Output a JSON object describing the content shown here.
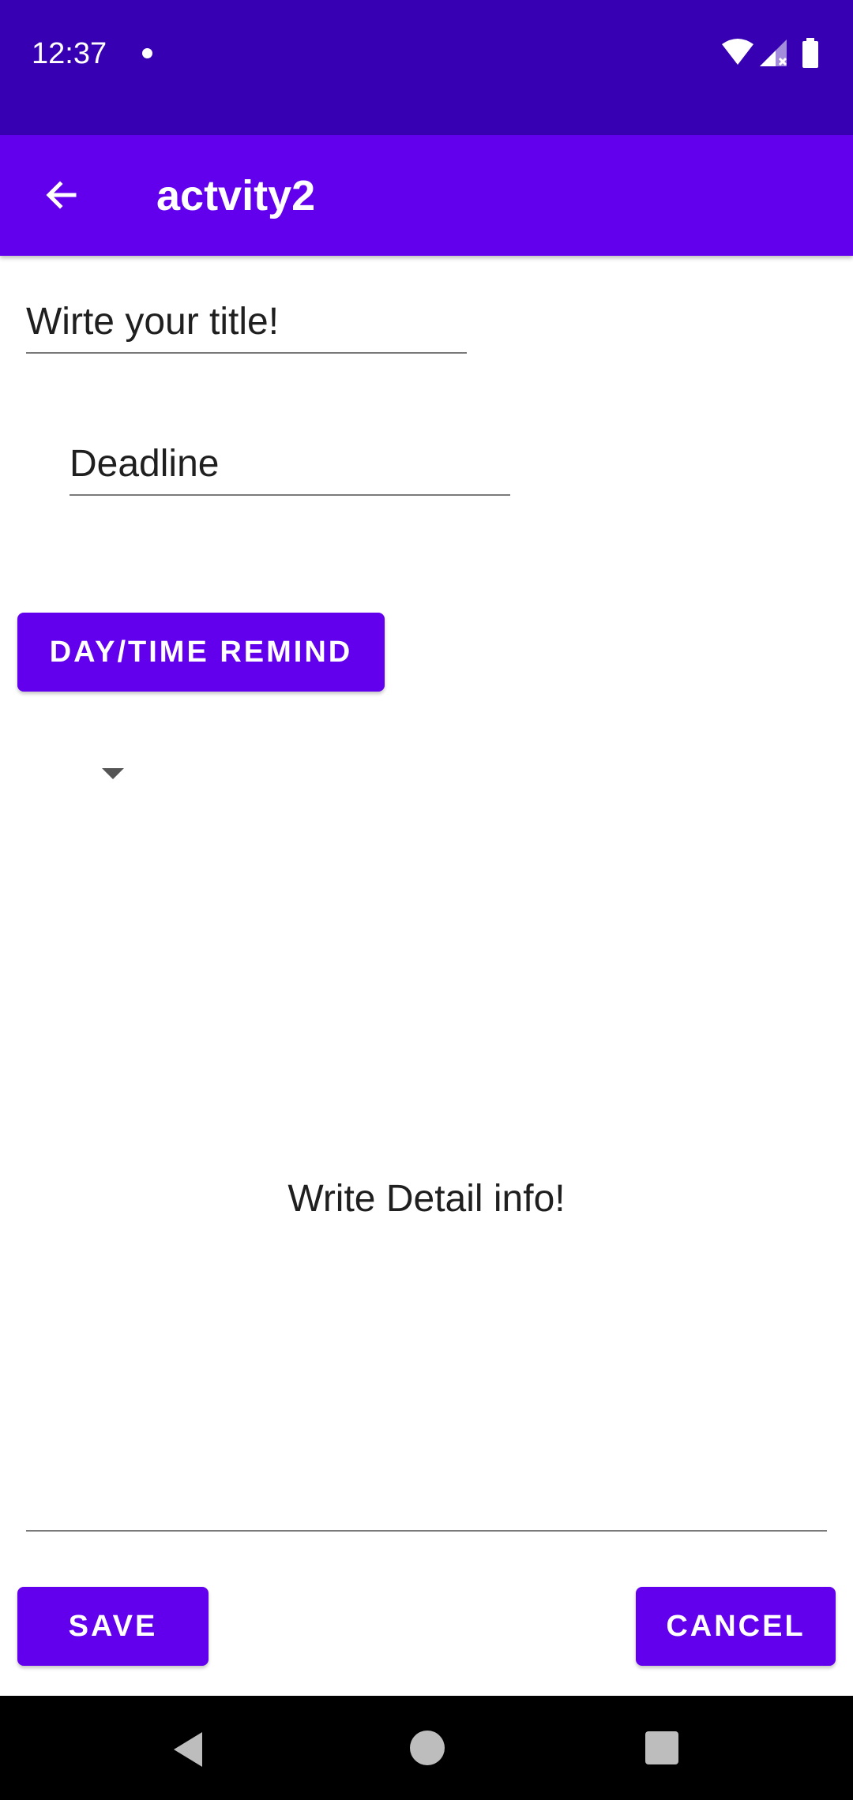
{
  "status_bar": {
    "time": "12:37",
    "icons": [
      "notification-dot-icon",
      "wifi-icon",
      "signal-icon",
      "battery-icon"
    ]
  },
  "app_bar": {
    "title": "actvity2",
    "back_icon": "arrow-back-icon",
    "color": "#6200ee"
  },
  "form": {
    "title_field": {
      "value": "Wirte your title!"
    },
    "deadline_field": {
      "value": "Deadline"
    },
    "remind_button_label": "DAY/TIME REMIND",
    "spinner": {
      "selected": "",
      "icon": "dropdown-arrow-icon"
    },
    "detail_field": {
      "value": "Write Detail info!"
    }
  },
  "actions": {
    "save_label": "SAVE",
    "cancel_label": "CANCEL"
  },
  "nav_bar": {
    "icons": [
      "nav-back-icon",
      "nav-home-icon",
      "nav-recents-icon"
    ]
  },
  "colors": {
    "status_bar": "#3700b3",
    "primary": "#6200ee"
  }
}
